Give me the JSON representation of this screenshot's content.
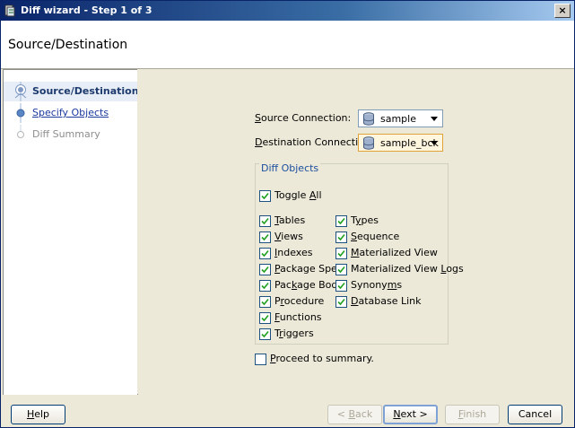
{
  "window": {
    "title": "Diff wizard - Step 1 of 3",
    "close_glyph": "×"
  },
  "header": {
    "title": "Source/Destination"
  },
  "steps": [
    {
      "label": "Source/Destination",
      "state": "active"
    },
    {
      "label": "Specify Objects",
      "state": "link"
    },
    {
      "label": "Diff Summary",
      "state": "disabled"
    }
  ],
  "source": {
    "label_pre": "S",
    "label_rest": "ource Connection:",
    "value": "sample"
  },
  "destination": {
    "label_pre": "D",
    "label_rest": "estination Connection:",
    "value": "sample_bck"
  },
  "diff_objects": {
    "legend": "Diff Objects",
    "toggle_all": {
      "pre": "Toggle ",
      "u": "A",
      "rest": "ll",
      "checked": true
    },
    "left": [
      {
        "pre": "",
        "u": "T",
        "rest": "ables",
        "checked": true
      },
      {
        "pre": "",
        "u": "V",
        "rest": "iews",
        "checked": true
      },
      {
        "pre": "",
        "u": "I",
        "rest": "ndexes",
        "checked": true
      },
      {
        "pre": "",
        "u": "P",
        "rest": "ackage Spec",
        "checked": true
      },
      {
        "pre": "Pac",
        "u": "k",
        "rest": "age Body",
        "checked": true
      },
      {
        "pre": "P",
        "u": "r",
        "rest": "ocedure",
        "checked": true
      },
      {
        "pre": "",
        "u": "F",
        "rest": "unctions",
        "checked": true
      },
      {
        "pre": "T",
        "u": "r",
        "rest": "iggers",
        "checked": true
      }
    ],
    "right": [
      {
        "pre": "T",
        "u": "y",
        "rest": "pes",
        "checked": true
      },
      {
        "pre": "",
        "u": "S",
        "rest": "equence",
        "checked": true
      },
      {
        "pre": "",
        "u": "M",
        "rest": "aterialized View",
        "checked": true
      },
      {
        "pre": "Materialized View ",
        "u": "L",
        "rest": "ogs",
        "checked": true
      },
      {
        "pre": "Synony",
        "u": "m",
        "rest": "s",
        "checked": true
      },
      {
        "pre": "",
        "u": "D",
        "rest": "atabase Link",
        "checked": true
      }
    ]
  },
  "proceed": {
    "pre": "",
    "u": "P",
    "rest": "roceed to summary.",
    "checked": false
  },
  "buttons": {
    "help": {
      "u": "H",
      "rest": "elp"
    },
    "back": {
      "pre": "< ",
      "u": "B",
      "rest": "ack"
    },
    "next": {
      "u": "N",
      "rest": "ext >"
    },
    "finish": {
      "u": "F",
      "rest": "inish"
    },
    "cancel": {
      "label": "Cancel"
    }
  },
  "colors": {
    "accent": "#1c3a6e",
    "link": "#1c3a9e",
    "focus": "#e2a23a"
  }
}
